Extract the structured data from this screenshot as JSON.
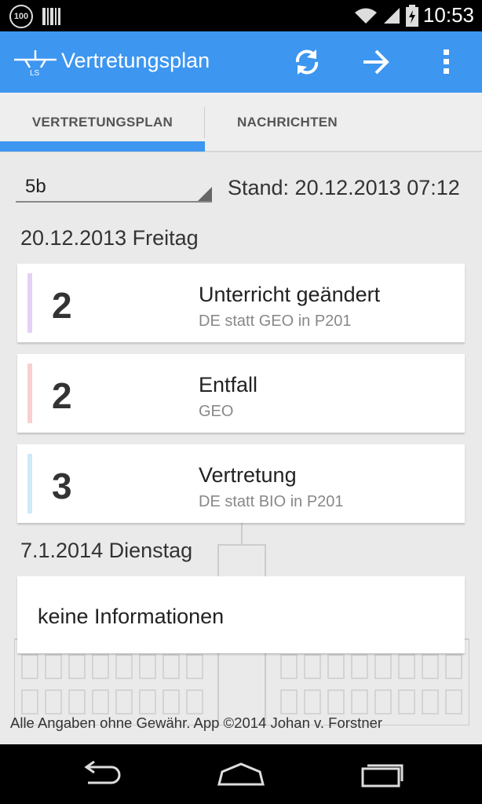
{
  "status_bar": {
    "battery_badge": "100",
    "time": "10:53",
    "icons": [
      "notification-100-icon",
      "barcode-icon",
      "wifi-icon",
      "signal-icon",
      "battery-charging-icon"
    ]
  },
  "action_bar": {
    "title": "Vertretungsplan",
    "logo_text": "LS",
    "accent_color": "#3d96f0",
    "icons": [
      "refresh-icon",
      "arrow-forward-icon",
      "overflow-menu-icon"
    ]
  },
  "tabs": [
    {
      "label": "VERTRETUNGSPLAN",
      "selected": true
    },
    {
      "label": "NACHRICHTEN",
      "selected": false
    }
  ],
  "class_selector": {
    "value": "5b"
  },
  "stand": "Stand: 20.12.2013 07:12",
  "days": [
    {
      "header": "20.12.2013 Freitag",
      "entries": [
        {
          "hour": "2",
          "title": "Unterricht geändert",
          "detail": "DE statt GEO in P201",
          "color": "#e4d2f5"
        },
        {
          "hour": "2",
          "title": "Entfall",
          "detail": "GEO",
          "color": "#f9d0cf"
        },
        {
          "hour": "3",
          "title": "Vertretung",
          "detail": "DE statt BIO in P201",
          "color": "#cfe9f8"
        }
      ]
    },
    {
      "header": "7.1.2014 Dienstag",
      "empty_text": "keine Informationen"
    }
  ],
  "footer": "Alle Angaben ohne Gewähr. App ©2014 Johan v. Forstner",
  "nav_bar": {
    "icons": [
      "back-icon",
      "home-icon",
      "recent-apps-icon"
    ]
  }
}
